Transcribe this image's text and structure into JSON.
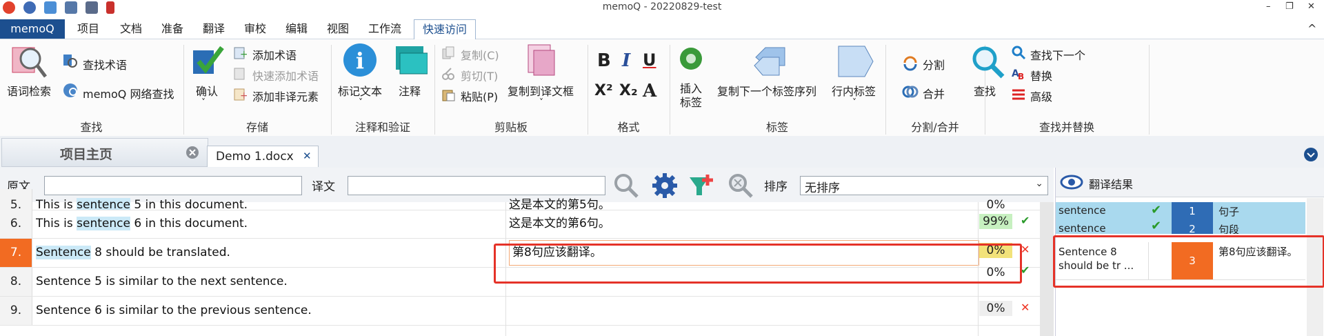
{
  "window": {
    "title": "memoQ - 20220829-test",
    "minimize": "–",
    "restore": "❐",
    "close": "✕",
    "collapse": "^"
  },
  "ribbon_tabs": [
    "memoQ",
    "项目",
    "文档",
    "准备",
    "翻译",
    "审校",
    "编辑",
    "视图",
    "工作流",
    "快速访问"
  ],
  "groups": {
    "find": {
      "label": "查找",
      "lookup": "语词检索",
      "find_term": "查找术语",
      "web_search": "memoQ 网络查找"
    },
    "store": {
      "label": "存储",
      "confirm": "确认",
      "add_term": "添加术语",
      "quick_add_term": "快速添加术语",
      "add_nontrans": "添加非译元素"
    },
    "annotate": {
      "label": "注释和验证",
      "mark_text": "标记文本",
      "comment": "注释"
    },
    "clipboard": {
      "label": "剪贴板",
      "copy": "复制(C)",
      "cut": "剪切(T)",
      "paste": "粘贴(P)",
      "copy_to_target": "复制到译文框"
    },
    "format": {
      "label": "格式",
      "bold": "B",
      "italic": "I",
      "underline": "U",
      "sup": "X²",
      "sub": "X₂",
      "case": "A"
    },
    "tags": {
      "label": "标签",
      "insert_tag": "插入\n标签",
      "copy_next_tag": "复制下一个标签序列",
      "inline_tag": "行内标签"
    },
    "split": {
      "label": "分割/合并",
      "split": "分割",
      "join": "合并"
    },
    "findreplace": {
      "label": "查找并替换",
      "find": "查找",
      "find_next": "查找下一个",
      "replace": "替换",
      "advanced": "高级"
    }
  },
  "doc_tabs": {
    "home": "项目主页",
    "doc": "Demo 1.docx",
    "close": "✕"
  },
  "filter": {
    "source_label": "原文",
    "target_label": "译文",
    "sort_label": "排序",
    "sort_value": "无排序"
  },
  "rows": [
    {
      "num": "5.",
      "pre": "This is ",
      "term": "sentence",
      "post": " 5 in this document.",
      "target": "这是本文的第5句。",
      "pct": "0%",
      "status": "✔"
    },
    {
      "num": "6.",
      "pre": "This is ",
      "term": "sentence",
      "post": " 6 in this document.",
      "target": "这是本文的第6句。",
      "pct": "99%",
      "status": "✔"
    },
    {
      "num": "7.",
      "pre": "",
      "term": "Sentence",
      "post": " 8 should be translated.",
      "target": "第8句应该翻译。",
      "pct": "0%",
      "status": "✕"
    },
    {
      "num": "8.",
      "pre": "",
      "term": "",
      "post": "Sentence 5 is similar to the next sentence.",
      "target": "",
      "pct": "0%",
      "status": "✔"
    },
    {
      "num": "9.",
      "pre": "",
      "term": "",
      "post": "Sentence 6 is similar to the previous sentence.",
      "target": "",
      "pct": "0%",
      "status": "✕"
    }
  ],
  "results": {
    "title": "翻译结果",
    "rows": [
      {
        "src": "sentence",
        "num": "1",
        "tgt": "句子"
      },
      {
        "src": "sentence",
        "num": "2",
        "tgt": "句段"
      },
      {
        "src": "Sentence 8 should be tr ...",
        "num": "3",
        "tgt": "第8句应该翻译。"
      }
    ]
  },
  "colors": {
    "accent": "#1c4f8f",
    "highlight": "#cbe9f7",
    "active_row": "#f26b22",
    "annotation": "#e53228"
  }
}
